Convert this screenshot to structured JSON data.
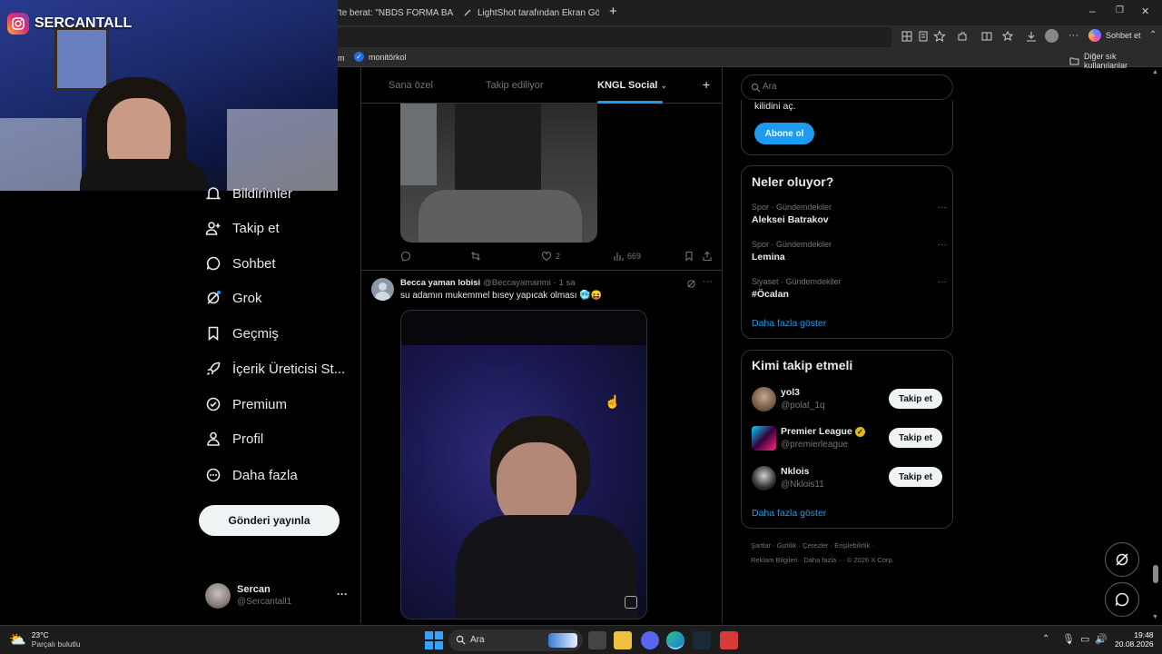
{
  "browser": {
    "tabs": [
      {
        "title": "Yeni Sekme"
      },
      {
        "title": "'te berat: \"NBDS FORMA BANDA\""
      },
      {
        "title": "LightShot tarafından Ekran Görün"
      }
    ],
    "new_tab": "+",
    "chat_button": "Sohbet et",
    "bookmark_left": "m",
    "bookmark_item": "monitörkol",
    "bookmark_other": "Diğer sık kullanılanlar",
    "window_min": "–",
    "window_max": "❐",
    "window_close": "✕"
  },
  "webcam": {
    "channel": "SERCANTALL"
  },
  "sidebar": {
    "items": [
      {
        "label": "Bildirimler",
        "icon": "bell-icon"
      },
      {
        "label": "Takip et",
        "icon": "person-add-icon"
      },
      {
        "label": "Sohbet",
        "icon": "chat-icon"
      },
      {
        "label": "Grok",
        "icon": "grok-icon"
      },
      {
        "label": "Geçmiş",
        "icon": "bookmark-icon"
      },
      {
        "label": "İçerik Üreticisi St...",
        "icon": "rocket-icon"
      },
      {
        "label": "Premium",
        "icon": "verified-icon"
      },
      {
        "label": "Profil",
        "icon": "profile-icon"
      },
      {
        "label": "Daha fazla",
        "icon": "more-circle-icon"
      }
    ],
    "post_button": "Gönderi yayınla",
    "account": {
      "name": "Sercan",
      "handle": "@Sercantall1",
      "more": "···"
    }
  },
  "feed": {
    "tabs": [
      "Sana özel",
      "Takip ediliyor",
      "KNGL Social"
    ],
    "active_tab": "KNGL Social",
    "add_tab": "+",
    "post1": {
      "likes": "2",
      "views": "669"
    },
    "post2": {
      "author": "Becca yaman lobisi",
      "handle": "@Beccayamanmi",
      "time": "· 1 sa",
      "text": "su adamın mukemmel bısey yapıcak olması 🥶😝"
    }
  },
  "right": {
    "search_placeholder": "Ara",
    "premium_text": "kilidini aç.",
    "subscribe_button": "Abone ol",
    "trends_title": "Neler oluyor?",
    "trends": [
      {
        "context": "Spor · Gündemdekiler",
        "name": "Aleksei Batrakov"
      },
      {
        "context": "Spor · Gündemdekiler",
        "name": "Lemina"
      },
      {
        "context": "Siyaset · Gündemdekiler",
        "name": "#Öcalan"
      }
    ],
    "show_more": "Daha fazla göster",
    "who_title": "Kimi takip etmeli",
    "who": [
      {
        "name": "yol3",
        "handle": "@polat_1q",
        "button": "Takip et"
      },
      {
        "name": "Premier League",
        "handle": "@premierleague",
        "button": "Takip et"
      },
      {
        "name": "Nklois",
        "handle": "@Nklois11",
        "button": "Takip et"
      }
    ],
    "show_more2": "Daha fazla göster",
    "footer_line1": "Şartlar  ·  Gizlilik  ·  Çerezler  ·  Erişilebilirlik  ·",
    "footer_line2": "Reklam Bilgileri  ·  Daha fazla ···  © 2026 X Corp."
  },
  "taskbar": {
    "weather_temp": "23°C",
    "weather_desc": "Parçalı bulutlu",
    "search": "Ara",
    "time": "19:48",
    "date": "20.08.2026"
  },
  "colors": {
    "accent": "#1d9bf0",
    "background": "#000000",
    "border": "#2f3336",
    "muted": "#71767b"
  }
}
